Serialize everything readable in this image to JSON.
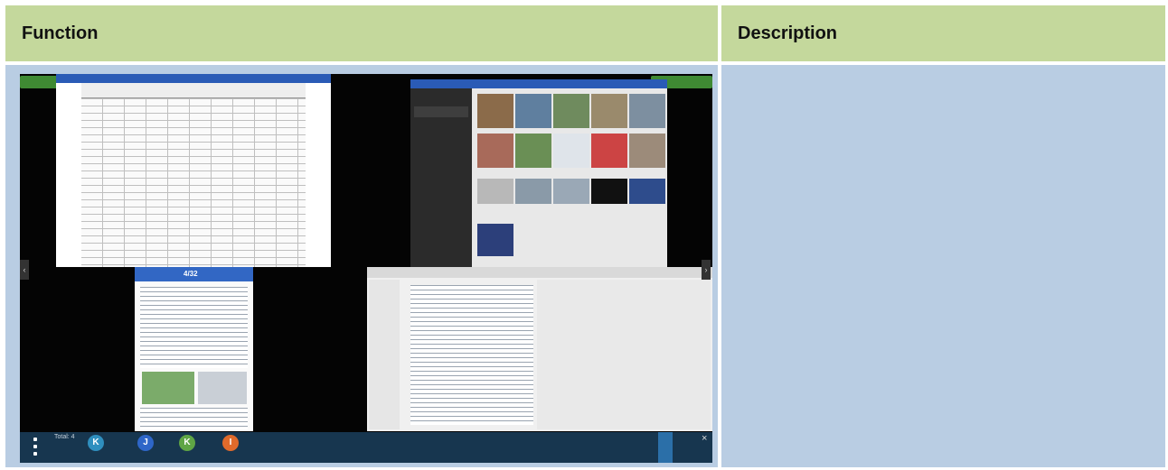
{
  "table": {
    "headers": [
      "Function",
      "Description"
    ]
  },
  "screenshot": {
    "dock": {
      "total_label": "Total: 4",
      "avatars": [
        {
          "letter": "K",
          "color": "#2f8fbf"
        },
        {
          "letter": "J",
          "color": "#2e66c8"
        },
        {
          "letter": "K",
          "color": "#5fa545"
        },
        {
          "letter": "I",
          "color": "#e06a2b"
        }
      ],
      "close_glyph": "×"
    },
    "nav_arrows": {
      "left": "‹",
      "right": "›"
    },
    "pdf_page": "4/32",
    "colors": {
      "accent_header": "#c4d89c",
      "cell_bg": "#b9cde3",
      "window_bar": "#2a5bb6",
      "dock": "#17364f"
    }
  }
}
